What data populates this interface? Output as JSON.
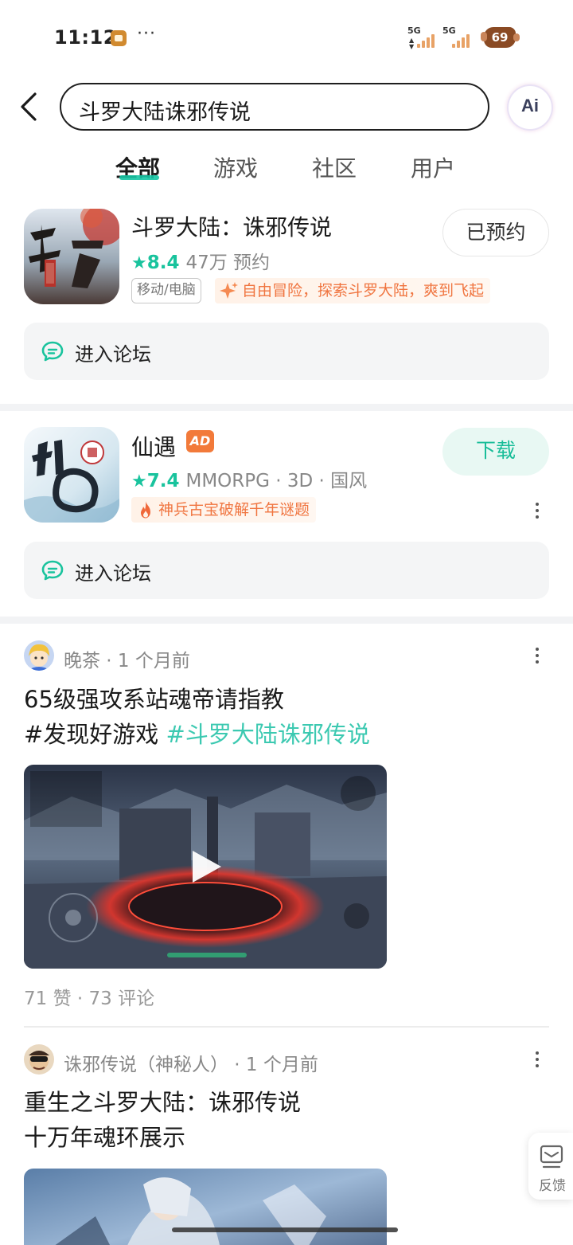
{
  "status_bar": {
    "time": "11:12",
    "more": "···",
    "signal_1": "5G",
    "signal_2": "5G",
    "battery": "69"
  },
  "header": {
    "search_value": "斗罗大陆诛邪传说",
    "ai_label": "Ai"
  },
  "tabs": [
    {
      "label": "全部",
      "active": true
    },
    {
      "label": "游戏",
      "active": false
    },
    {
      "label": "社区",
      "active": false
    },
    {
      "label": "用户",
      "active": false
    }
  ],
  "games": [
    {
      "name": "斗罗大陆：诛邪传说",
      "rating": "8.4",
      "stats": "47万 预约",
      "platform": "移动/电脑",
      "highlight": "自由冒险，探索斗罗大陆，爽到飞起",
      "action": "已预约",
      "forum": "进入论坛"
    },
    {
      "name": "仙遇",
      "ad": "AD",
      "rating": "7.4",
      "stats": "MMORPG · 3D · 国风",
      "highlight": "神兵古宝破解千年谜题",
      "action": "下载",
      "forum": "进入论坛"
    }
  ],
  "posts": [
    {
      "author": "晚茶",
      "time": " · 1 个月前",
      "title_line1": "65级强攻系站魂帝请指教",
      "tag1": "#发现好游戏",
      "tag2": "#斗罗大陆诛邪传说",
      "stats": "71 赞 · 73 评论"
    },
    {
      "author": "诛邪传说（神秘人）",
      "time": " · 1 个月前",
      "title_line1": "重生之斗罗大陆：诛邪传说",
      "title_line2": "十万年魂环展示"
    }
  ],
  "feedback_label": "反馈",
  "colors": {
    "accent": "#16c5a4",
    "highlight_text": "#f07540",
    "ad_badge": "#f27a3a"
  }
}
